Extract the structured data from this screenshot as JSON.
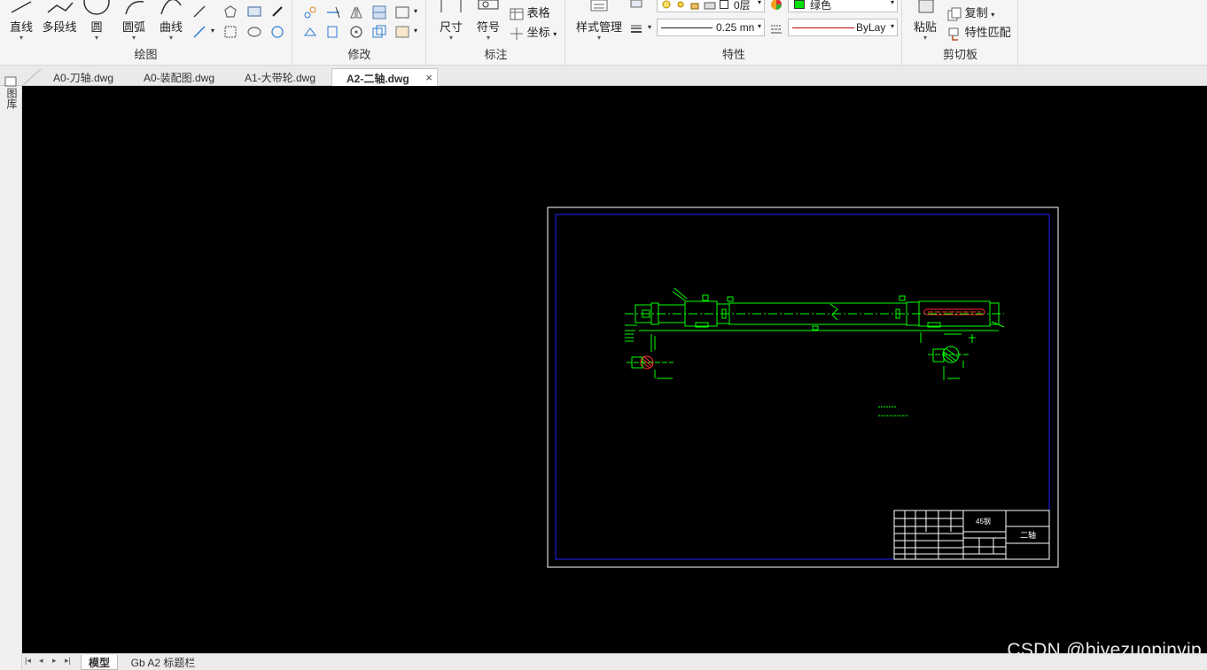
{
  "ribbon": {
    "draw": {
      "label": "绘图",
      "line": "直线",
      "polyline": "多段线",
      "circle": "圆",
      "arc": "圆弧",
      "curve": "曲线"
    },
    "modify": {
      "label": "修改"
    },
    "annotate": {
      "label": "标注",
      "dimension": "尺寸",
      "symbol": "符号",
      "table": "表格",
      "coordinate": "坐标"
    },
    "properties": {
      "label": "特性",
      "style_manager": "样式管理",
      "layer": "0层",
      "color": "绿色",
      "lineweight": "0.25 mn",
      "linetype": "ByLay"
    },
    "clipboard": {
      "label": "剪切板",
      "paste": "粘贴",
      "copy": "复制",
      "match": "特性匹配"
    }
  },
  "tabs": [
    {
      "label": "A0-刀轴.dwg",
      "active": false
    },
    {
      "label": "A0-装配图.dwg",
      "active": false
    },
    {
      "label": "A1-大带轮.dwg",
      "active": false
    },
    {
      "label": "A2-二轴.dwg",
      "active": true
    }
  ],
  "leftbar": {
    "label": "图库"
  },
  "drawing": {
    "material": "45钢",
    "part_name": "二轴"
  },
  "layout_tabs": [
    {
      "label": "模型",
      "active": true
    },
    {
      "label": "Gb A2 标题栏",
      "active": false
    }
  ],
  "watermark": "CSDN @biyezuopinvip",
  "colors": {
    "canvas": "#000000",
    "drawing_lines": "#00ff00",
    "frame_outer": "#ffffff",
    "frame_inner": "#0000ff",
    "section_hatch": "#ff0000"
  }
}
